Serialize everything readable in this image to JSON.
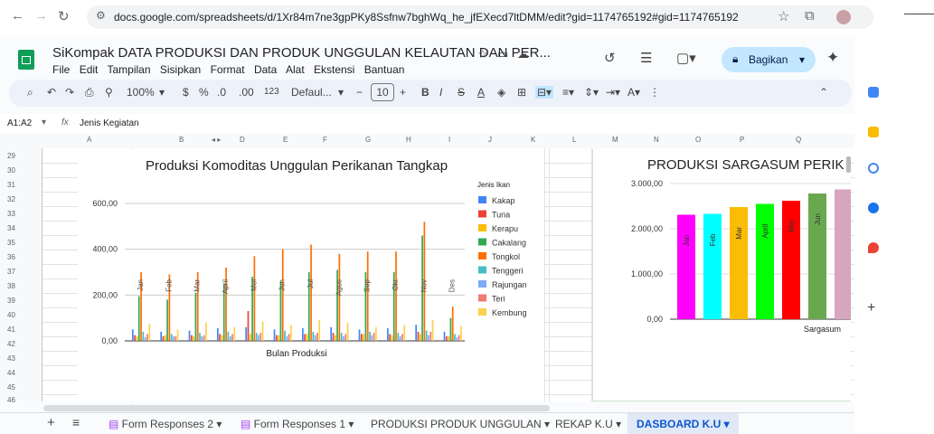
{
  "browser": {
    "url": "docs.google.com/spreadsheets/d/1Xr84m7ne3gpPKy8Ssfnw7bghWq_he_jfEXecd7ltDMM/edit?gid=1174765192#gid=1174765192"
  },
  "doc": {
    "title": "SiKompak DATA PRODUKSI DAN PRODUK UNGGULAN KELAUTAN DAN PER...",
    "menus": [
      "File",
      "Edit",
      "Tampilan",
      "Sisipkan",
      "Format",
      "Data",
      "Alat",
      "Ekstensi",
      "Bantuan"
    ],
    "share_label": "Bagikan"
  },
  "toolbar": {
    "zoom": "100%",
    "currency": "$",
    "percent": "%",
    "dec_less": ".0",
    "dec_more": ".00",
    "format_123": "123",
    "font": "Defaul...",
    "font_size": "10",
    "bold": "B",
    "italic": "I",
    "strike": "S",
    "text_color": "A"
  },
  "formula_bar": {
    "cell_ref": "A1:A2",
    "fx": "fx",
    "content": "Jenis Kegiatan"
  },
  "columns": [
    "A",
    "B",
    "D",
    "E",
    "F",
    "G",
    "H",
    "I",
    "J",
    "K",
    "L",
    "M",
    "N",
    "O",
    "P",
    "Q"
  ],
  "rows": [
    "29",
    "30",
    "31",
    "32",
    "33",
    "34",
    "35",
    "36",
    "37",
    "38",
    "39",
    "40",
    "41",
    "42",
    "43",
    "44",
    "45",
    "46"
  ],
  "sheet_tabs": [
    {
      "label": "Form Responses 2"
    },
    {
      "label": "Form Responses 1"
    },
    {
      "label": "PRODUKSI PRODUK UNGGULAN"
    },
    {
      "label": "REKAP K.U"
    },
    {
      "label": "DASBOARD K.U"
    }
  ],
  "chart_data": [
    {
      "type": "bar",
      "title": "Produksi Komoditas Unggulan Perikanan Tangkap",
      "xlabel": "Bulan Produksi",
      "ylabel": "",
      "ylim": [
        0,
        600
      ],
      "yticks": [
        "600,00",
        "400,00",
        "200,00",
        "0,00"
      ],
      "legend_title": "Jenis Ikan",
      "legend_position": "right",
      "categories": [
        "Jan",
        "Feb",
        "Mar",
        "April",
        "Mei",
        "Jun",
        "Jul",
        "Agus",
        "Sep",
        "Okt",
        "Nov",
        "Des"
      ],
      "series": [
        {
          "name": "Kakap",
          "color": "#4285f4",
          "values": [
            50,
            40,
            45,
            55,
            60,
            50,
            55,
            60,
            50,
            55,
            70,
            40
          ]
        },
        {
          "name": "Tuna",
          "color": "#ea4335",
          "values": [
            25,
            20,
            25,
            30,
            130,
            25,
            30,
            35,
            30,
            30,
            40,
            20
          ]
        },
        {
          "name": "Kerapu",
          "color": "#fbbc04",
          "values": [
            20,
            25,
            20,
            25,
            30,
            25,
            30,
            25,
            30,
            25,
            30,
            20
          ]
        },
        {
          "name": "Cakalang",
          "color": "#34a853",
          "values": [
            195,
            180,
            210,
            250,
            280,
            260,
            300,
            310,
            300,
            300,
            460,
            100
          ]
        },
        {
          "name": "Tongkol",
          "color": "#ff6d01",
          "values": [
            300,
            290,
            300,
            320,
            370,
            400,
            420,
            380,
            390,
            390,
            520,
            150
          ]
        },
        {
          "name": "Tenggeri",
          "color": "#46bdc6",
          "values": [
            40,
            30,
            35,
            40,
            35,
            45,
            40,
            35,
            40,
            35,
            45,
            30
          ]
        },
        {
          "name": "Rajungan",
          "color": "#7baaf7",
          "values": [
            15,
            20,
            20,
            20,
            25,
            20,
            25,
            20,
            25,
            20,
            25,
            15
          ]
        },
        {
          "name": "Teri",
          "color": "#f07b72",
          "values": [
            30,
            20,
            25,
            30,
            35,
            30,
            35,
            30,
            35,
            30,
            40,
            25
          ]
        },
        {
          "name": "Kembung",
          "color": "#fcd04f",
          "values": [
            75,
            50,
            80,
            60,
            85,
            70,
            90,
            80,
            60,
            70,
            90,
            65
          ]
        }
      ]
    },
    {
      "type": "bar",
      "title": "PRODUKSI SARGASUM PERIK",
      "xlabel": "",
      "ylabel": "",
      "ylim": [
        0,
        3000
      ],
      "yticks": [
        "3.000,00",
        "2.000,00",
        "1.000,00",
        "0,00"
      ],
      "x_category_label": "Sargasum",
      "categories": [
        "Jan",
        "Feb",
        "Mar",
        "April",
        "Mei",
        "Jun",
        ""
      ],
      "values": [
        2310,
        2330,
        2480,
        2550,
        2620,
        2780,
        2870
      ],
      "colors": [
        "#ff00ff",
        "#00ffff",
        "#fbbc04",
        "#00ff00",
        "#ff0000",
        "#6aa84f",
        "#d5a6bd"
      ]
    }
  ]
}
